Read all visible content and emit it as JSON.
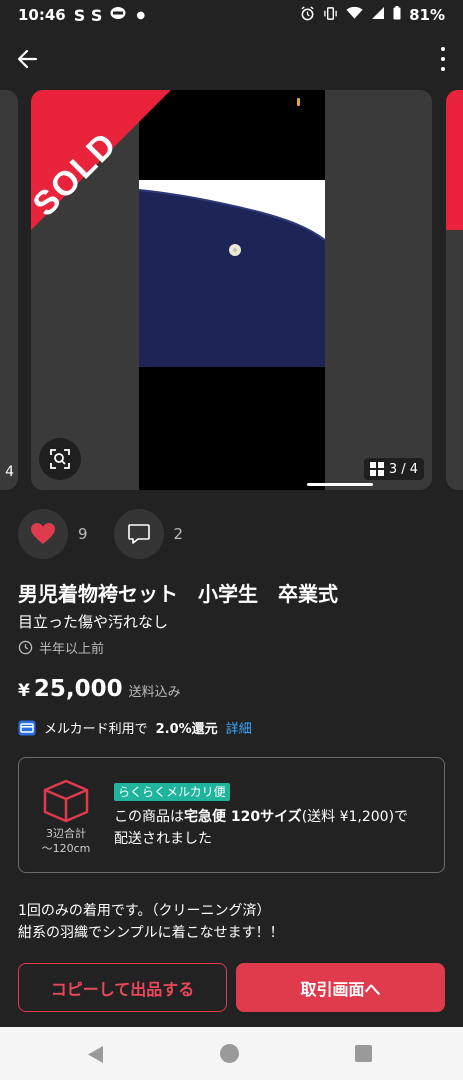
{
  "status_bar": {
    "time": "10:46",
    "notifications": "S S",
    "battery": "81%"
  },
  "listing": {
    "sold_label": "SOLD",
    "image_counter": "3 / 4",
    "prev_counter_peek": "4",
    "likes": "9",
    "comments": "2",
    "title": "男児着物袴セット　小学生　卒業式",
    "subtitle": "目立った傷や汚れなし",
    "time_ago": "半年以上前",
    "price_symbol": "¥",
    "price": "25,000",
    "price_note": "送料込み"
  },
  "mercard": {
    "text": "メルカード利用で",
    "percent": "2.0%還元",
    "detail_link": "詳細"
  },
  "shipping": {
    "box_label_line1": "3辺合計",
    "box_label_line2": "〜120cm",
    "tag": "らくらくメルカリ便",
    "line1_prefix": "この商品は",
    "line1_bold": "宅急便 120サイズ",
    "line1_suffix": "(送料 ¥1,200)で",
    "line2": "配送されました"
  },
  "description": {
    "line1": "1回のみの着用です。（クリーニング済）",
    "line2": "紺系の羽織でシンプルに着こなせます！！"
  },
  "buttons": {
    "copy": "コピーして出品する",
    "trade": "取引画面へ"
  },
  "colors": {
    "accent": "#e03a4d",
    "sold_ribbon": "#e8233b",
    "link": "#3ea8ff",
    "shipping_tag": "#1fb59d",
    "background": "#222222"
  },
  "icons": [
    "back-arrow-icon",
    "more-vert-icon",
    "heart-icon",
    "comment-icon",
    "clock-icon",
    "card-icon",
    "box-icon",
    "lens-search-icon",
    "grid-icon"
  ]
}
